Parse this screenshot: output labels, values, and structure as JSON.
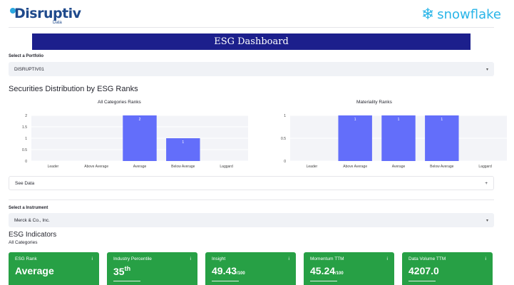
{
  "header": {
    "left_logo": "Disruptiv",
    "left_logo_sub": "Data",
    "right_logo": "snowflake",
    "right_logo_icon": "snowflake-icon",
    "title": "ESG Dashboard"
  },
  "portfolio": {
    "label": "Select a Portfolio",
    "value": "DISRUPTIV01",
    "caret": "▾"
  },
  "section_distribution": {
    "title": "Securities Distribution by ESG Ranks"
  },
  "chart_data": [
    {
      "type": "bar",
      "title": "All Categories Ranks",
      "categories": [
        "Leader",
        "Above Average",
        "Average",
        "Below Average",
        "Laggard"
      ],
      "values": [
        0,
        0,
        2,
        1,
        0
      ],
      "data_labels": [
        "",
        "",
        "2",
        "1",
        ""
      ],
      "yticks": [
        "0",
        "0.5",
        "1",
        "1.5",
        "2"
      ],
      "ylim": [
        0,
        2
      ],
      "bar_color": "#636efa",
      "grid": true
    },
    {
      "type": "bar",
      "title": "Materiality Ranks",
      "categories": [
        "Leader",
        "Above Average",
        "Average",
        "Below Average",
        "Laggard"
      ],
      "values": [
        0,
        1,
        1,
        1,
        0
      ],
      "data_labels": [
        "",
        "1",
        "1",
        "1",
        ""
      ],
      "yticks": [
        "0",
        "0.5",
        "1"
      ],
      "ylim": [
        0,
        1
      ],
      "bar_color": "#636efa",
      "grid": true
    }
  ],
  "expander": {
    "label": "See Data",
    "icon": "+"
  },
  "instrument": {
    "label": "Select a Instrument",
    "value": "Merck & Co., Inc.",
    "caret": "▾"
  },
  "indicators": {
    "title": "ESG Indicators",
    "subtitle": "All Categories",
    "info_icon": "i",
    "card_color": "#27a045",
    "cards": [
      {
        "title": "ESG Rank",
        "value": "Average",
        "sup": "",
        "suffix": ""
      },
      {
        "title": "Industry Percentile",
        "value": "35",
        "sup": "th",
        "suffix": ""
      },
      {
        "title": "Insight",
        "value": "49.43",
        "sup": "",
        "suffix": "/100"
      },
      {
        "title": "Momentum TTM",
        "value": "45.24",
        "sup": "",
        "suffix": "/100"
      },
      {
        "title": "Data Volume TTM",
        "value": "4207.0",
        "sup": "",
        "suffix": ""
      }
    ]
  }
}
